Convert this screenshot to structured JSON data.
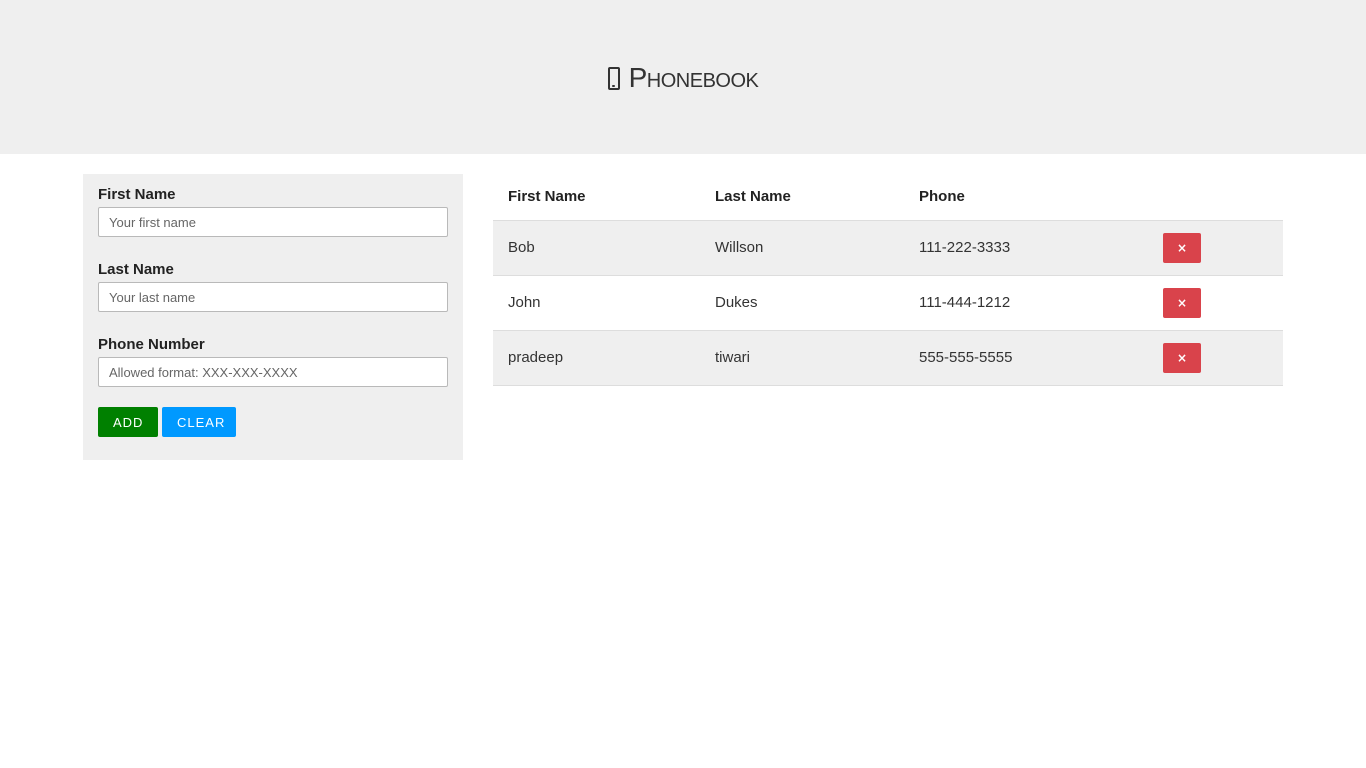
{
  "header": {
    "icon": "mobile-phone-icon",
    "title": "Phonebook"
  },
  "form": {
    "first_name_label": "First Name",
    "first_name_placeholder": "Your first name",
    "first_name_value": "",
    "last_name_label": "Last Name",
    "last_name_placeholder": "Your last name",
    "last_name_value": "",
    "phone_label": "Phone Number",
    "phone_placeholder": "Allowed format: XXX-XXX-XXXX",
    "phone_value": "",
    "add_label": "ADD",
    "clear_label": "CLEAR"
  },
  "table": {
    "headers": [
      "First Name",
      "Last Name",
      "Phone"
    ],
    "rows": [
      {
        "first": "Bob",
        "last": "Willson",
        "phone": "111-222-3333",
        "delete_label": "×"
      },
      {
        "first": "John",
        "last": "Dukes",
        "phone": "111-444-1212",
        "delete_label": "×"
      },
      {
        "first": "pradeep",
        "last": "tiwari",
        "phone": "555-555-5555",
        "delete_label": "×"
      }
    ]
  },
  "colors": {
    "header_bg": "#efefef",
    "add_button": "#008000",
    "clear_button": "#0099ff",
    "delete_button": "#d9434b"
  }
}
